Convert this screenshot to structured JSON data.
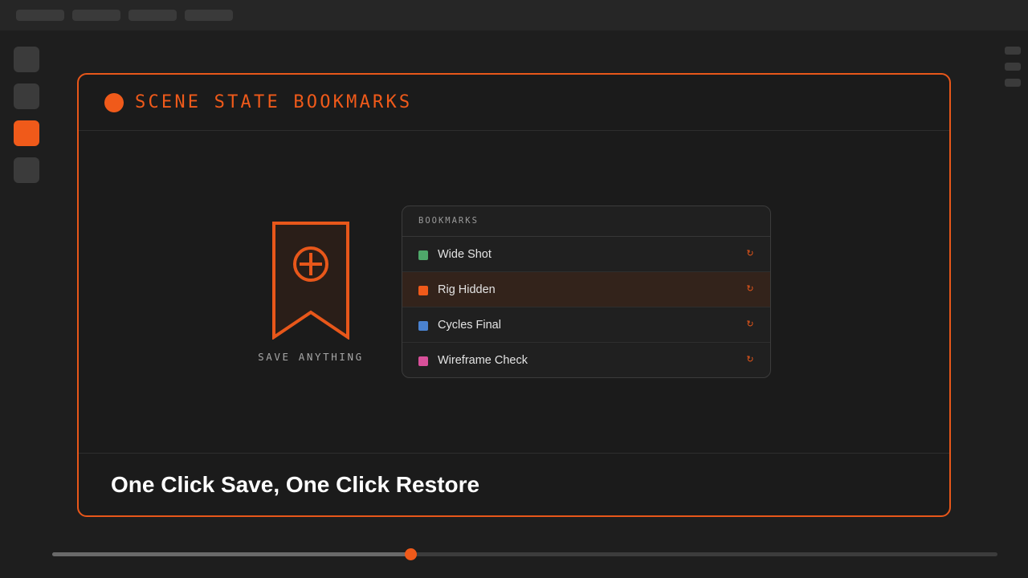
{
  "colors": {
    "accent": "#f05a1a",
    "background": "#1e1e1e",
    "card_background": "#1b1b1b"
  },
  "header": {
    "title": "SCENE STATE BOOKMARKS"
  },
  "illustration": {
    "icon": "bookmark-plus-icon",
    "label": "SAVE ANYTHING"
  },
  "bookmarks_panel": {
    "heading": "BOOKMARKS",
    "restore_icon": "restore-icon",
    "items": [
      {
        "label": "Wide Shot",
        "color": "#4fa86a",
        "selected": false
      },
      {
        "label": "Rig Hidden",
        "color": "#f05a1a",
        "selected": true
      },
      {
        "label": "Cycles Final",
        "color": "#4a82d0",
        "selected": false
      },
      {
        "label": "Wireframe Check",
        "color": "#d8509a",
        "selected": false
      }
    ]
  },
  "footer": {
    "title": "One Click Save, One Click Restore"
  },
  "timeline": {
    "progress": 0.379
  }
}
